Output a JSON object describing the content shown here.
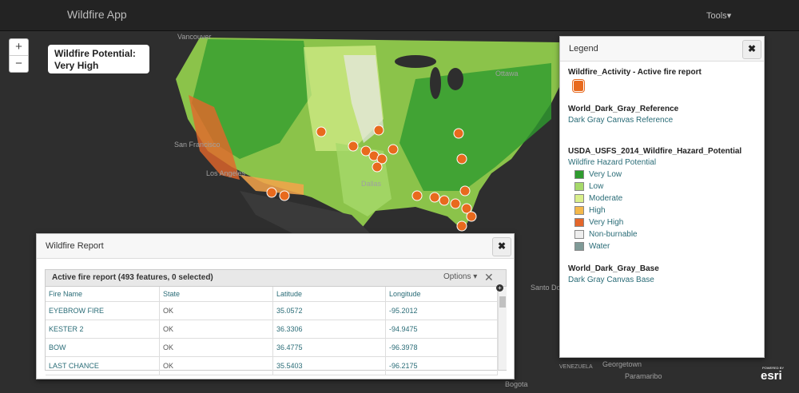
{
  "app": {
    "title": "Wildfire App",
    "tools_label": "Tools"
  },
  "map": {
    "zoom_in": "+",
    "zoom_out": "−",
    "places": [
      "Vancouver",
      "Ottawa",
      "San Francisco",
      "Los Angeles",
      "Dallas",
      "Santo Domingo",
      "Georgetown",
      "Paramaribo",
      "Bogota",
      "VENEZUELA"
    ],
    "colors": {
      "very_low": "#2e9b2e",
      "low": "#a6d96a",
      "moderate": "#d9ef8b",
      "high": "#f4a34a",
      "very_high": "#e4662a",
      "non_burnable": "#e8e8e8",
      "water": "#7a9a9a"
    }
  },
  "potential": {
    "label": "Wildfire Potential:",
    "value": "Very High"
  },
  "legend": {
    "title": "Legend",
    "close": "✖",
    "layers": [
      {
        "name": "Wildfire_Activity - Active fire report"
      },
      {
        "name": "World_Dark_Gray_Reference",
        "subtitle": "Dark Gray Canvas Reference"
      },
      {
        "name": "USDA_USFS_2014_Wildfire_Hazard_Potential",
        "subtitle": "Wildfire Hazard Potential"
      },
      {
        "name": "World_Dark_Gray_Base",
        "subtitle": "Dark Gray Canvas Base"
      }
    ],
    "hazard_items": [
      {
        "label": "Very Low",
        "color": "#2e9b2e"
      },
      {
        "label": "Low",
        "color": "#a6d96a"
      },
      {
        "label": "Moderate",
        "color": "#d9ef8b"
      },
      {
        "label": "High",
        "color": "#f4b84a"
      },
      {
        "label": "Very High",
        "color": "#e4662a"
      },
      {
        "label": "Non-burnable",
        "color": "#eeeeee"
      },
      {
        "label": "Water",
        "color": "#7f9a97"
      }
    ]
  },
  "report": {
    "title": "Wildfire Report",
    "close": "✖",
    "table_title": "Active fire report (493 features, 0 selected)",
    "options_label": "Options ▾",
    "clear": "✕",
    "columns": [
      "Fire Name",
      "State",
      "Latitude",
      "Longitude"
    ],
    "rows": [
      [
        "EYEBROW FIRE",
        "OK",
        "35.0572",
        "-95.2012"
      ],
      [
        "KESTER 2",
        "OK",
        "36.3306",
        "-94.9475"
      ],
      [
        "BOW",
        "OK",
        "36.4775",
        "-96.3978"
      ],
      [
        "LAST CHANCE",
        "OK",
        "35.5403",
        "-96.2175"
      ]
    ]
  },
  "attribution": {
    "powered": "POWERED BY",
    "brand": "esri"
  }
}
